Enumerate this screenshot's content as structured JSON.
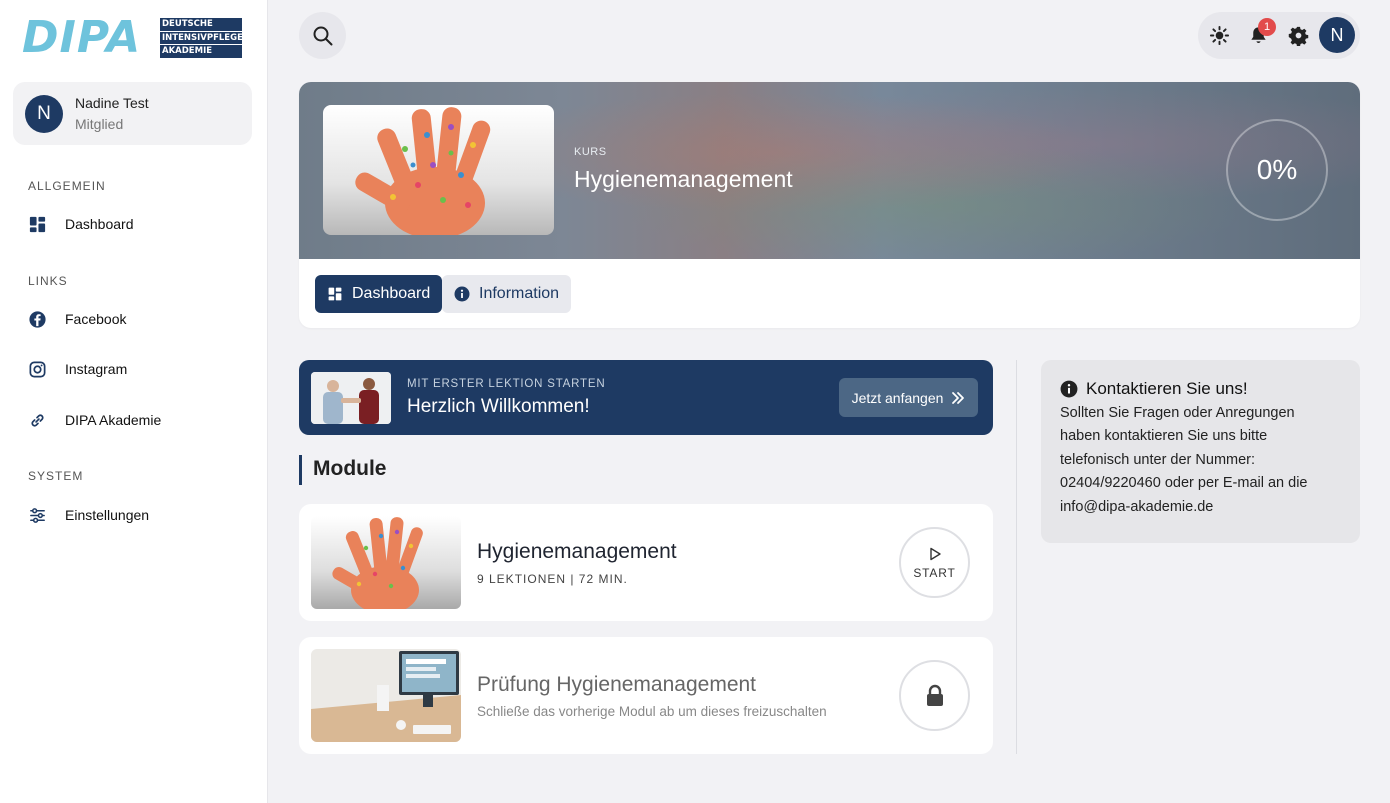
{
  "brand": {
    "logo_big": "DIPA",
    "logo_lines": [
      "DEUTSCHE",
      "INTENSIVPFLEGE",
      "AKADEMIE"
    ]
  },
  "user": {
    "initial": "N",
    "name": "Nadine Test",
    "role": "Mitglied"
  },
  "sidebar": {
    "sections": [
      {
        "title": "ALLGEMEIN",
        "items": [
          {
            "label": "Dashboard",
            "icon": "dashboard-icon"
          }
        ]
      },
      {
        "title": "LINKS",
        "items": [
          {
            "label": "Facebook",
            "icon": "facebook-icon"
          },
          {
            "label": "Instagram",
            "icon": "instagram-icon"
          },
          {
            "label": "DIPA Akademie",
            "icon": "link-icon"
          }
        ]
      },
      {
        "title": "SYSTEM",
        "items": [
          {
            "label": "Einstellungen",
            "icon": "sliders-icon"
          }
        ]
      }
    ]
  },
  "topbar": {
    "notification_count": "1",
    "avatar_initial": "N"
  },
  "course": {
    "label": "KURS",
    "title": "Hygienemanagement",
    "progress": "0%",
    "tabs": [
      {
        "label": "Dashboard",
        "active": true
      },
      {
        "label": "Information",
        "active": false
      }
    ]
  },
  "start_banner": {
    "small": "MIT ERSTER LEKTION STARTEN",
    "title": "Herzlich Willkommen!",
    "button": "Jetzt anfangen"
  },
  "modules": {
    "heading": "Module",
    "items": [
      {
        "title": "Hygienemanagement",
        "meta": "9 LEKTIONEN | 72 MIN.",
        "action": "START",
        "locked": false
      },
      {
        "title": "Prüfung Hygienemanagement",
        "meta": "Schließe das vorherige Modul ab um dieses freizuschalten",
        "locked": true
      }
    ]
  },
  "contact": {
    "title": "Kontaktieren Sie uns!",
    "lines": [
      "Sollten Sie Fragen oder Anregungen",
      "haben kontaktieren Sie uns bitte",
      "telefonisch unter der Nummer:",
      "02404/9220460 oder per E-mail an die",
      "info@dipa-akademie.de"
    ]
  },
  "colors": {
    "primary": "#1e3a63",
    "logo_blue": "#6ec3dc",
    "badge": "#e24b4b",
    "background": "#f2f2f5"
  }
}
